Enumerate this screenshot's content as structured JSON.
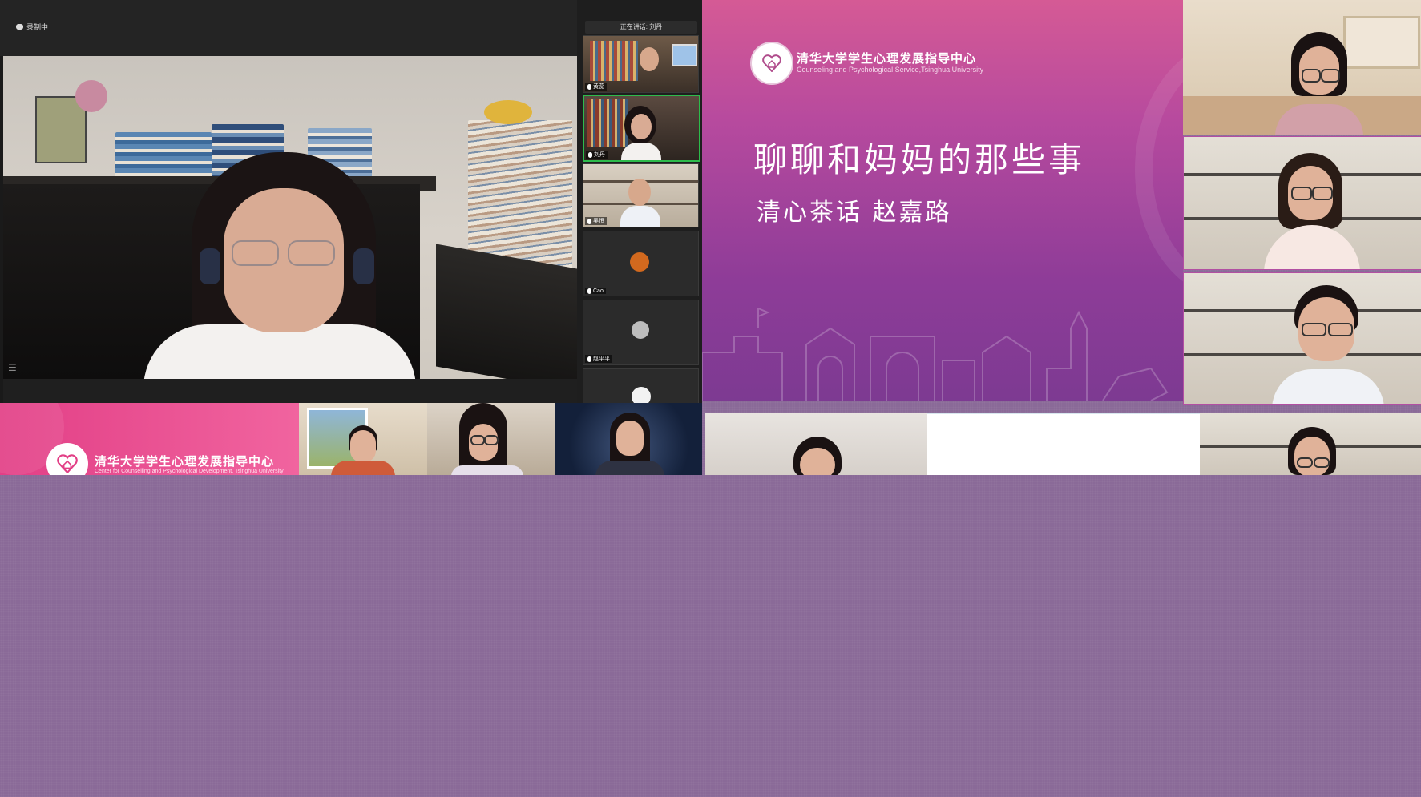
{
  "zoom": {
    "recording_label": "录制中",
    "speaking_label": "正在讲话: 刘丹",
    "participants": [
      {
        "name": "黄蕊"
      },
      {
        "name": "刘丹"
      },
      {
        "name": "吴恒"
      },
      {
        "name": "Cao"
      },
      {
        "name": "赵平平"
      }
    ]
  },
  "slide": {
    "org_cn": "清华大学学生心理发展指导中心",
    "org_en": "Counseling and Psychological Service,Tsinghua University",
    "title": "聊聊和妈妈的那些事",
    "subtitle": "清心茶话  赵嘉路"
  },
  "banner": {
    "org_cn": "清华大学学生心理发展指导中心",
    "org_en": "Center for Counselling and Psychological Development, Tsinghua University"
  },
  "colors": {
    "slide_top": "#d55a95",
    "slide_bottom": "#7d3a92",
    "desktop": "#8a6a98",
    "active_speaker": "#2dbb4b",
    "banner_pink": "#e23f86"
  },
  "icons": [
    "cloud-record-icon",
    "mic-icon",
    "heart-logo-icon",
    "menu-icon"
  ]
}
